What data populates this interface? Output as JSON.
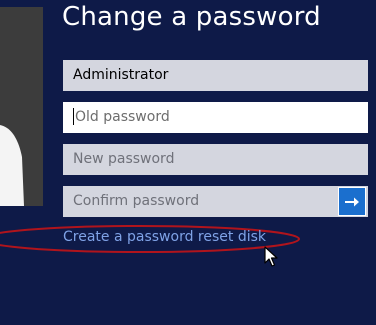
{
  "title": "Change a password",
  "fields": {
    "username": "Administrator",
    "old_password_placeholder": "Old password",
    "new_password_placeholder": "New password",
    "confirm_password_placeholder": "Confirm password"
  },
  "submit_icon": "arrow-right-icon",
  "reset_link": "Create a password reset disk",
  "colors": {
    "background": "#0e1a48",
    "field_fill": "#d4d6df",
    "submit_button": "#1b6fce",
    "link": "#7fa2e6",
    "annotation_ellipse": "#b0141c"
  }
}
